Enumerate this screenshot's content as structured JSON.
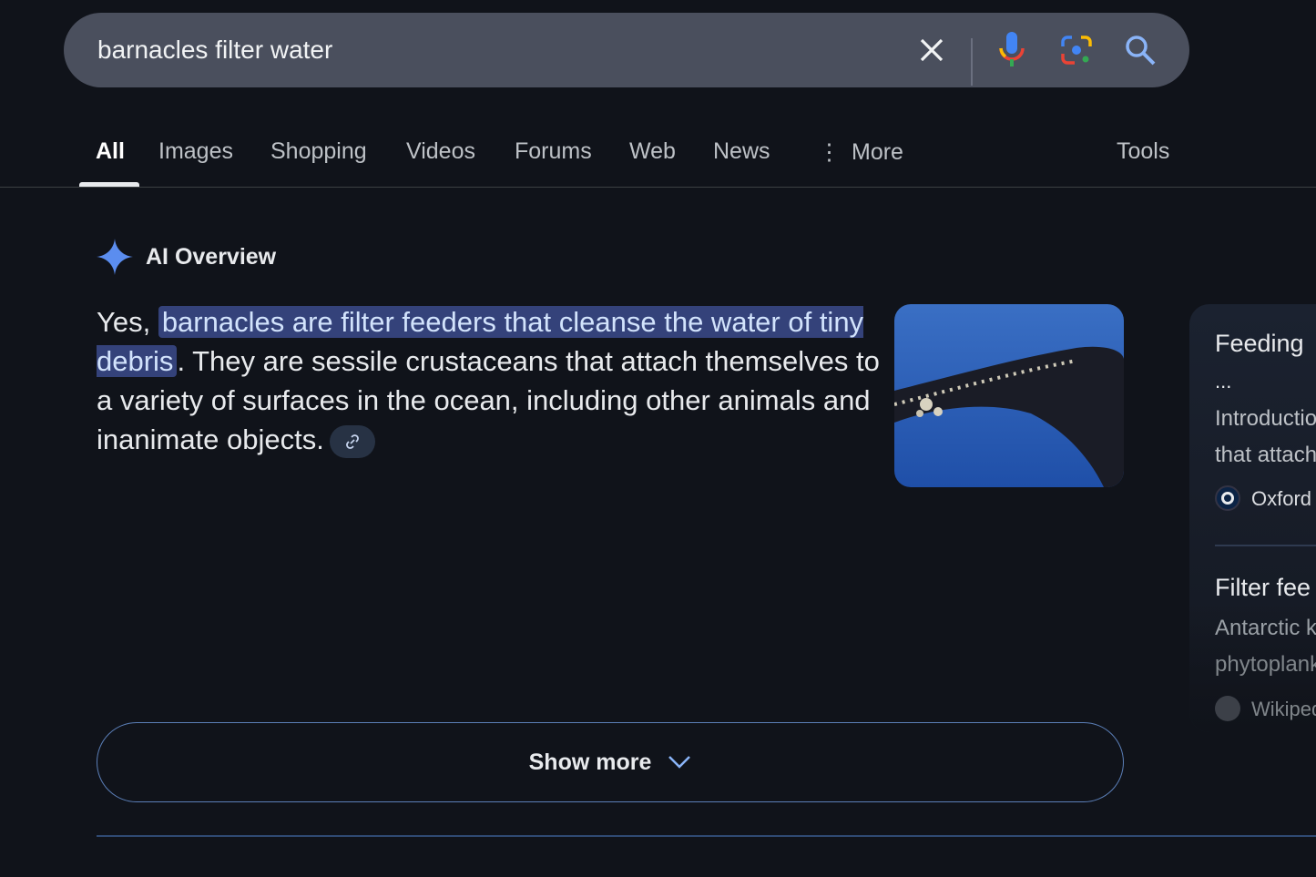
{
  "search": {
    "query": "barnacles filter water",
    "icons": [
      "close-icon",
      "microphone-icon",
      "google-lens-icon",
      "search-icon"
    ]
  },
  "tabs": [
    {
      "label": "All",
      "active": true
    },
    {
      "label": "Images"
    },
    {
      "label": "Shopping"
    },
    {
      "label": "Videos"
    },
    {
      "label": "Forums"
    },
    {
      "label": "Web"
    },
    {
      "label": "News"
    },
    {
      "label": "More"
    }
  ],
  "tools_label": "Tools",
  "ai_overview": {
    "title": "AI Overview",
    "answer_prefix": "Yes, ",
    "answer_highlight": "barnacles are filter feeders that cleanse the water of tiny debris",
    "answer_rest": ". They are sessile crustaceans that attach them­selves to a variety of surfaces in the ocean, including other animals and inanimate objects."
  },
  "sources": [
    {
      "title": "Feeding",
      "title2": "...",
      "snippet1": "Introductio",
      "snippet2": "that attach",
      "site": "Oxford"
    },
    {
      "title": "Filter fee",
      "snippet1": "Antarctic k",
      "snippet2": "phytoplank",
      "site": "Wikiped"
    }
  ],
  "show_more_label": "Show more",
  "colors": {
    "accent": "#8ab4f8",
    "highlight": "#34427a",
    "background": "#10131a"
  }
}
